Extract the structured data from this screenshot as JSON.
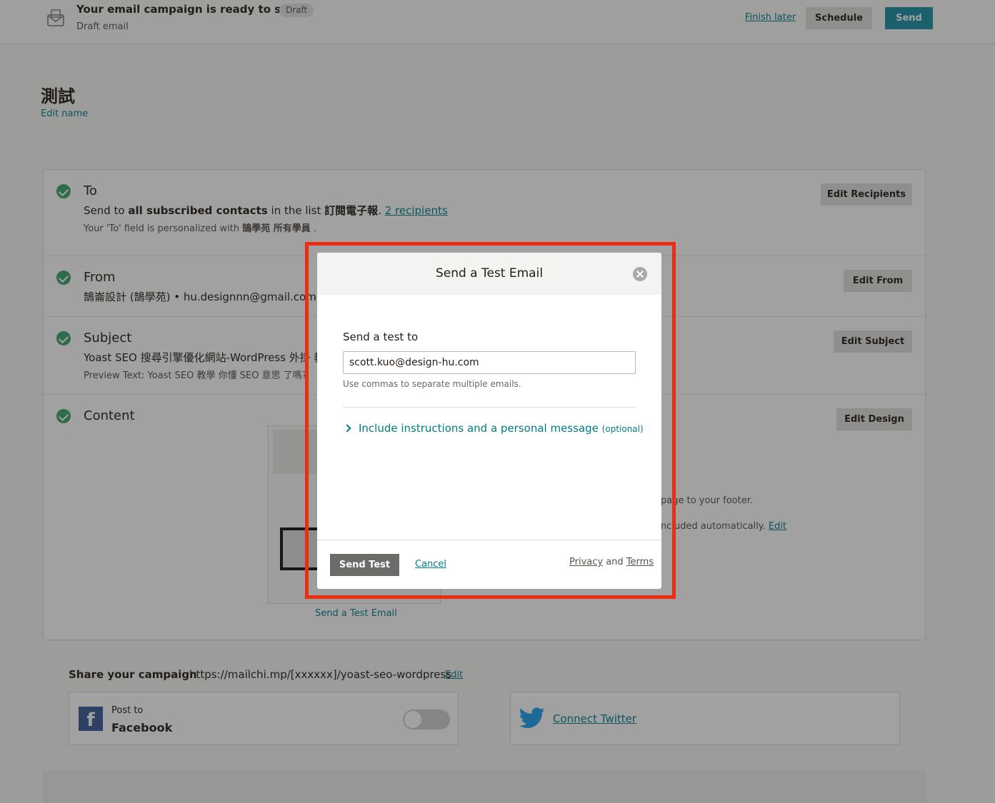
{
  "header": {
    "title": "Your email campaign is ready to send!",
    "badge": "Draft",
    "subtitle": "Draft email",
    "finish_later": "Finish later",
    "schedule": "Schedule",
    "send": "Send"
  },
  "campaign": {
    "name": "測試",
    "edit_name": "Edit name"
  },
  "checklist": {
    "to": {
      "title": "To",
      "text_prefix": "Send to",
      "text_bold": "all subscribed contacts",
      "text_mid": "in the list",
      "list_name": "訂閱電子報",
      "recipients": "2 recipients",
      "note_prefix": "Your 'To' field is personalized with",
      "note_bold": "鵠學苑 所有學員",
      "button": "Edit Recipients"
    },
    "from": {
      "title": "From",
      "text": "鵠崙設計 (鵠學苑) • hu.designnn@gmail.com",
      "button": "Edit From"
    },
    "subject": {
      "title": "Subject",
      "text": "Yoast SEO 搜尋引擎優化網站-WordPress 外掛 教",
      "preview": "Preview Text: Yoast SEO 教學 你懂 SEO 意思 了嗎?",
      "button": "Edit Subject"
    },
    "content": {
      "title": "Content",
      "button": "Edit Design",
      "footer_line1": "page to your footer.",
      "footer_line2": "ncluded automatically.",
      "footer_edit": "Edit",
      "send_test_link": "Send a Test Email"
    }
  },
  "share": {
    "label": "Share your campaign",
    "url": "https://mailchi.mp/[xxxxxx]/yoast-seo-wordpress",
    "edit": "Edit",
    "facebook_post": "Post to",
    "facebook_name": "Facebook",
    "twitter": "Connect Twitter"
  },
  "modal": {
    "title": "Send a Test Email",
    "field_label": "Send a test to",
    "email_value": "scott.kuo@design-hu.com",
    "help": "Use commas to separate multiple emails.",
    "expander": "Include instructions and a personal message",
    "optional": "(optional)",
    "send_test": "Send Test",
    "cancel": "Cancel",
    "privacy": "Privacy",
    "and": "and",
    "terms": "Terms"
  },
  "colors": {
    "accent": "#007c89",
    "send_button": "#1d8fa6",
    "check": "#39a46d",
    "highlight": "#ec2d12"
  }
}
